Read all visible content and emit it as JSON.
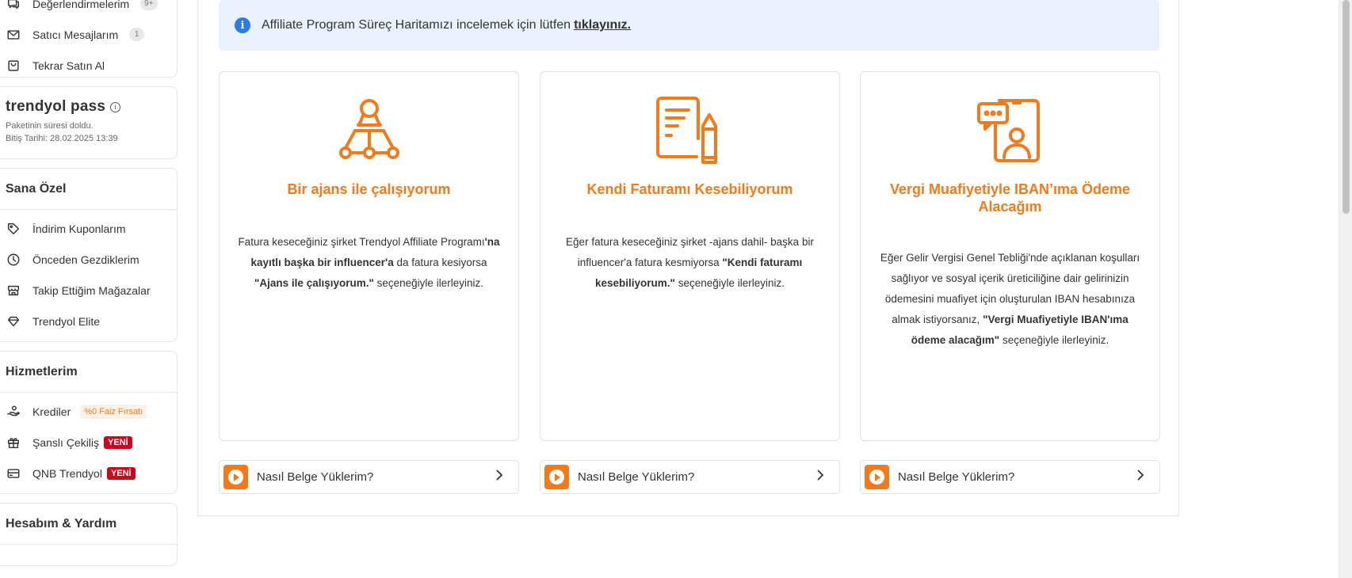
{
  "sidebar": {
    "top_items": [
      {
        "label": "Değerlendirmelerim",
        "badge": "9+",
        "icon": "comment-review-icon"
      },
      {
        "label": "Satıcı Mesajlarım",
        "badge": "1",
        "icon": "mail-icon"
      },
      {
        "label": "Tekrar Satın Al",
        "badge": "",
        "icon": "bag-icon"
      }
    ],
    "pass": {
      "title": "trendyol pass",
      "info_glyph": "i",
      "status": "Paketinin süresi doldu.",
      "end_date": "Bitiş Tarihi: 28.02.2025 13:39"
    },
    "special": {
      "title": "Sana Özel",
      "items": [
        {
          "label": "İndirim Kuponlarım",
          "icon": "tag-icon"
        },
        {
          "label": "Önceden Gezdiklerim",
          "icon": "clock-icon"
        },
        {
          "label": "Takip Ettiğim Mağazalar",
          "icon": "store-icon"
        },
        {
          "label": "Trendyol Elite",
          "icon": "diamond-icon"
        }
      ]
    },
    "services": {
      "title": "Hizmetlerim",
      "items": [
        {
          "label": "Krediler",
          "icon": "coins-hand-icon",
          "tag": "%0 Faiz Fırsatı"
        },
        {
          "label": "Şanslı Çekiliş",
          "icon": "gift-icon",
          "tag": "YENİ"
        },
        {
          "label": "QNB Trendyol",
          "icon": "card-icon",
          "tag": "YENİ"
        }
      ]
    },
    "account": {
      "title": "Hesabım & Yardım"
    }
  },
  "info_bar": {
    "icon_glyph": "i",
    "text": "Affiliate Program Süreç Haritamızı incelemek için lütfen",
    "link": "tıklayınız."
  },
  "cards": [
    {
      "title": "Bir ajans ile çalışıyorum",
      "icon": "agency-network-icon",
      "p1": "Fatura keseceğiniz şirket Trendyol Affiliate Programı",
      "b1": "'na kayıtlı başka bir influencer'a",
      "p2": " da fatura kesiyorsa ",
      "b2": "\"Ajans ile çalışıyorum.\"",
      "p3": " seçeneğiyle ilerleyiniz."
    },
    {
      "title": "Kendi Faturamı Kesebiliyorum",
      "icon": "invoice-pen-icon",
      "p1": "Eğer fatura keseceğiniz şirket -ajans dahil- başka bir influencer'a fatura kesmiyorsa ",
      "b1": "\"Kendi faturamı kesebiliyorum.\"",
      "p2": " seçeneğiyle ilerleyiniz."
    },
    {
      "title": "Vergi Muafiyetiyle IBAN’ıma Ödeme Alacağım",
      "icon": "phone-chat-user-icon",
      "p1": "Eğer Gelir Vergisi Genel Tebliği'nde açıklanan koşulları sağlıyor ve sosyal içerik üreticiliğine dair gelirinizin ödemesini muafiyet için oluşturulan IBAN hesabınıza almak istiyorsanız, ",
      "b1": "\"Vergi Muafiyetiyle IBAN'ıma ödeme alacağım\"",
      "p2": " seçeneğiyle ilerleyiniz."
    }
  ],
  "howto": {
    "label": "Nasıl Belge Yüklerim?"
  },
  "colors": {
    "brand_orange": "#f27a1a",
    "info_blue": "#2a7de1",
    "info_bg": "#eaf3fd",
    "new_red": "#d0021b"
  }
}
